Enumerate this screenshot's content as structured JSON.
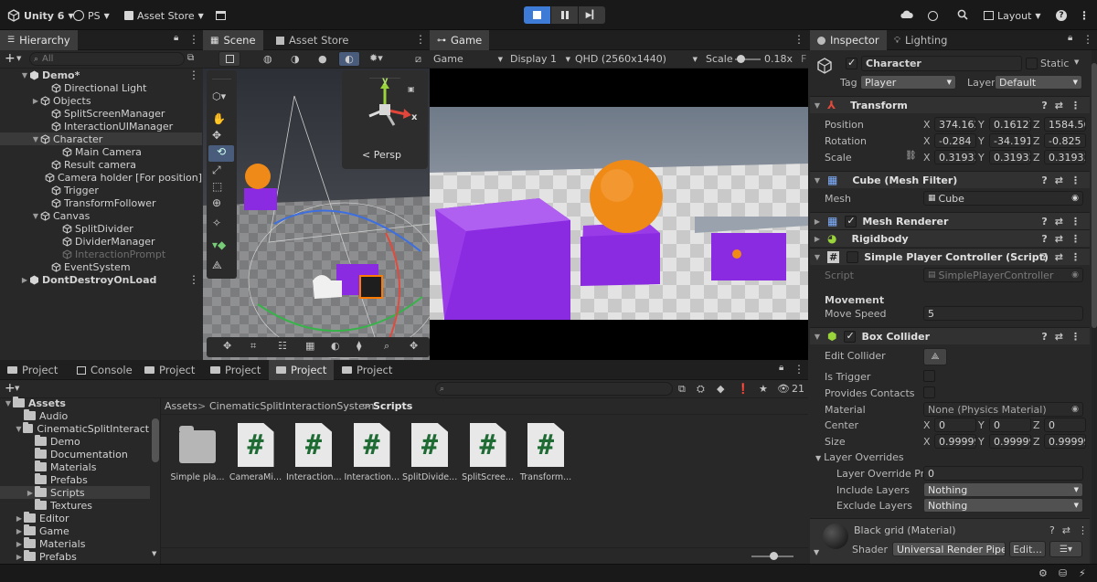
{
  "toolbar": {
    "app_name": "Unity 6",
    "account": "PS",
    "asset_store": "Asset Store",
    "layout": "Layout",
    "help": "?"
  },
  "hierarchy": {
    "tab": "Hierarchy",
    "search_placeholder": "All",
    "items": [
      {
        "label": "Demo*",
        "depth": 0,
        "type": "scene"
      },
      {
        "label": "Directional Light",
        "depth": 2,
        "type": "go"
      },
      {
        "label": "Objects",
        "depth": 1,
        "type": "go"
      },
      {
        "label": "SplitScreenManager",
        "depth": 2,
        "type": "go"
      },
      {
        "label": "InteractionUIManager",
        "depth": 2,
        "type": "go"
      },
      {
        "label": "Character",
        "depth": 1,
        "type": "go"
      },
      {
        "label": "Main Camera",
        "depth": 3,
        "type": "go"
      },
      {
        "label": "Result camera",
        "depth": 2,
        "type": "go"
      },
      {
        "label": "Camera holder [For position]",
        "depth": 2,
        "type": "go"
      },
      {
        "label": "Trigger",
        "depth": 2,
        "type": "go"
      },
      {
        "label": "TransformFollower",
        "depth": 2,
        "type": "go"
      },
      {
        "label": "Canvas",
        "depth": 1,
        "type": "go"
      },
      {
        "label": "SplitDivider",
        "depth": 3,
        "type": "go"
      },
      {
        "label": "DividerManager",
        "depth": 3,
        "type": "go"
      },
      {
        "label": "InteractionPrompt",
        "depth": 3,
        "type": "go"
      },
      {
        "label": "EventSystem",
        "depth": 2,
        "type": "go"
      },
      {
        "label": "DontDestroyOnLoad",
        "depth": 0,
        "type": "scene"
      }
    ]
  },
  "scene": {
    "tab_scene": "Scene",
    "tab_asset_store": "Asset Store",
    "persp_label": "< Persp",
    "gizmo_y": "y",
    "gizmo_x": "x"
  },
  "game": {
    "tab": "Game",
    "view_mode": "Game",
    "display": "Display 1",
    "resolution": "QHD (2560x1440)",
    "scale_label": "Scale",
    "scale_value": "0.18x",
    "more": "F"
  },
  "inspector": {
    "tab_inspector": "Inspector",
    "tab_lighting": "Lighting",
    "object_name": "Character",
    "static_label": "Static",
    "tag_label": "Tag",
    "tag_value": "Player",
    "layer_label": "Layer",
    "layer_value": "Default",
    "transform": {
      "title": "Transform",
      "position_label": "Position",
      "rotation_label": "Rotation",
      "scale_label": "Scale",
      "position": [
        "374.162",
        "0.16127",
        "1584.56"
      ],
      "rotation": [
        "-0.284",
        "-34.191",
        "-0.825"
      ],
      "scale": [
        "0.31933",
        "0.31933",
        "0.31933"
      ]
    },
    "mesh_filter": {
      "title": "Cube (Mesh Filter)",
      "mesh_label": "Mesh",
      "mesh_value": "Cube"
    },
    "mesh_renderer": {
      "title": "Mesh Renderer"
    },
    "rigidbody": {
      "title": "Rigidbody"
    },
    "player_controller": {
      "title": "Simple Player Controller (Script)",
      "script_label": "Script",
      "script_value": "SimplePlayerController",
      "movement_header": "Movement",
      "move_speed_label": "Move Speed",
      "move_speed_value": "5"
    },
    "box_collider": {
      "title": "Box Collider",
      "edit_collider": "Edit Collider",
      "is_trigger": "Is Trigger",
      "provides_contacts": "Provides Contacts",
      "material_label": "Material",
      "material_value": "None (Physics Material)",
      "center_label": "Center",
      "center": [
        "0",
        "0",
        "0"
      ],
      "size_label": "Size",
      "size": [
        "0.99999",
        "0.99999",
        "0.99999"
      ],
      "layer_overrides": "Layer Overrides",
      "layer_override_priority_label": "Layer Override Pric",
      "layer_override_priority_value": "0",
      "include_layers_label": "Include Layers",
      "include_layers_value": "Nothing",
      "exclude_layers_label": "Exclude Layers",
      "exclude_layers_value": "Nothing"
    },
    "material": {
      "title": "Black grid (Material)",
      "shader_label": "Shader",
      "shader_value": "Universal Render Pipe",
      "edit_button": "Edit..."
    },
    "axis": {
      "x": "X",
      "y": "Y",
      "z": "Z"
    }
  },
  "bottom_tabs": [
    "Project",
    "Console",
    "Project",
    "Project",
    "Project",
    "Project"
  ],
  "project": {
    "tree": [
      {
        "label": "Assets",
        "depth": 0,
        "bold": true
      },
      {
        "label": "Audio",
        "depth": 1
      },
      {
        "label": "CinematicSplitInteraction",
        "depth": 1
      },
      {
        "label": "Demo",
        "depth": 2
      },
      {
        "label": "Documentation",
        "depth": 2
      },
      {
        "label": "Materials",
        "depth": 2
      },
      {
        "label": "Prefabs",
        "depth": 2
      },
      {
        "label": "Scripts",
        "depth": 2
      },
      {
        "label": "Textures",
        "depth": 2
      },
      {
        "label": "Editor",
        "depth": 1
      },
      {
        "label": "Game",
        "depth": 1
      },
      {
        "label": "Materials",
        "depth": 1
      },
      {
        "label": "Prefabs",
        "depth": 1
      }
    ],
    "breadcrumb": [
      "Assets",
      "CinematicSplitInteractionSystem",
      "Scripts"
    ],
    "assets": [
      {
        "label": "Simple pla...",
        "kind": "folder"
      },
      {
        "label": "CameraMi...",
        "kind": "script"
      },
      {
        "label": "Interaction...",
        "kind": "script"
      },
      {
        "label": "Interaction...",
        "kind": "script"
      },
      {
        "label": "SplitDivide...",
        "kind": "script"
      },
      {
        "label": "SplitScree...",
        "kind": "script"
      },
      {
        "label": "Transform...",
        "kind": "script"
      }
    ],
    "hidden_count": "21"
  }
}
